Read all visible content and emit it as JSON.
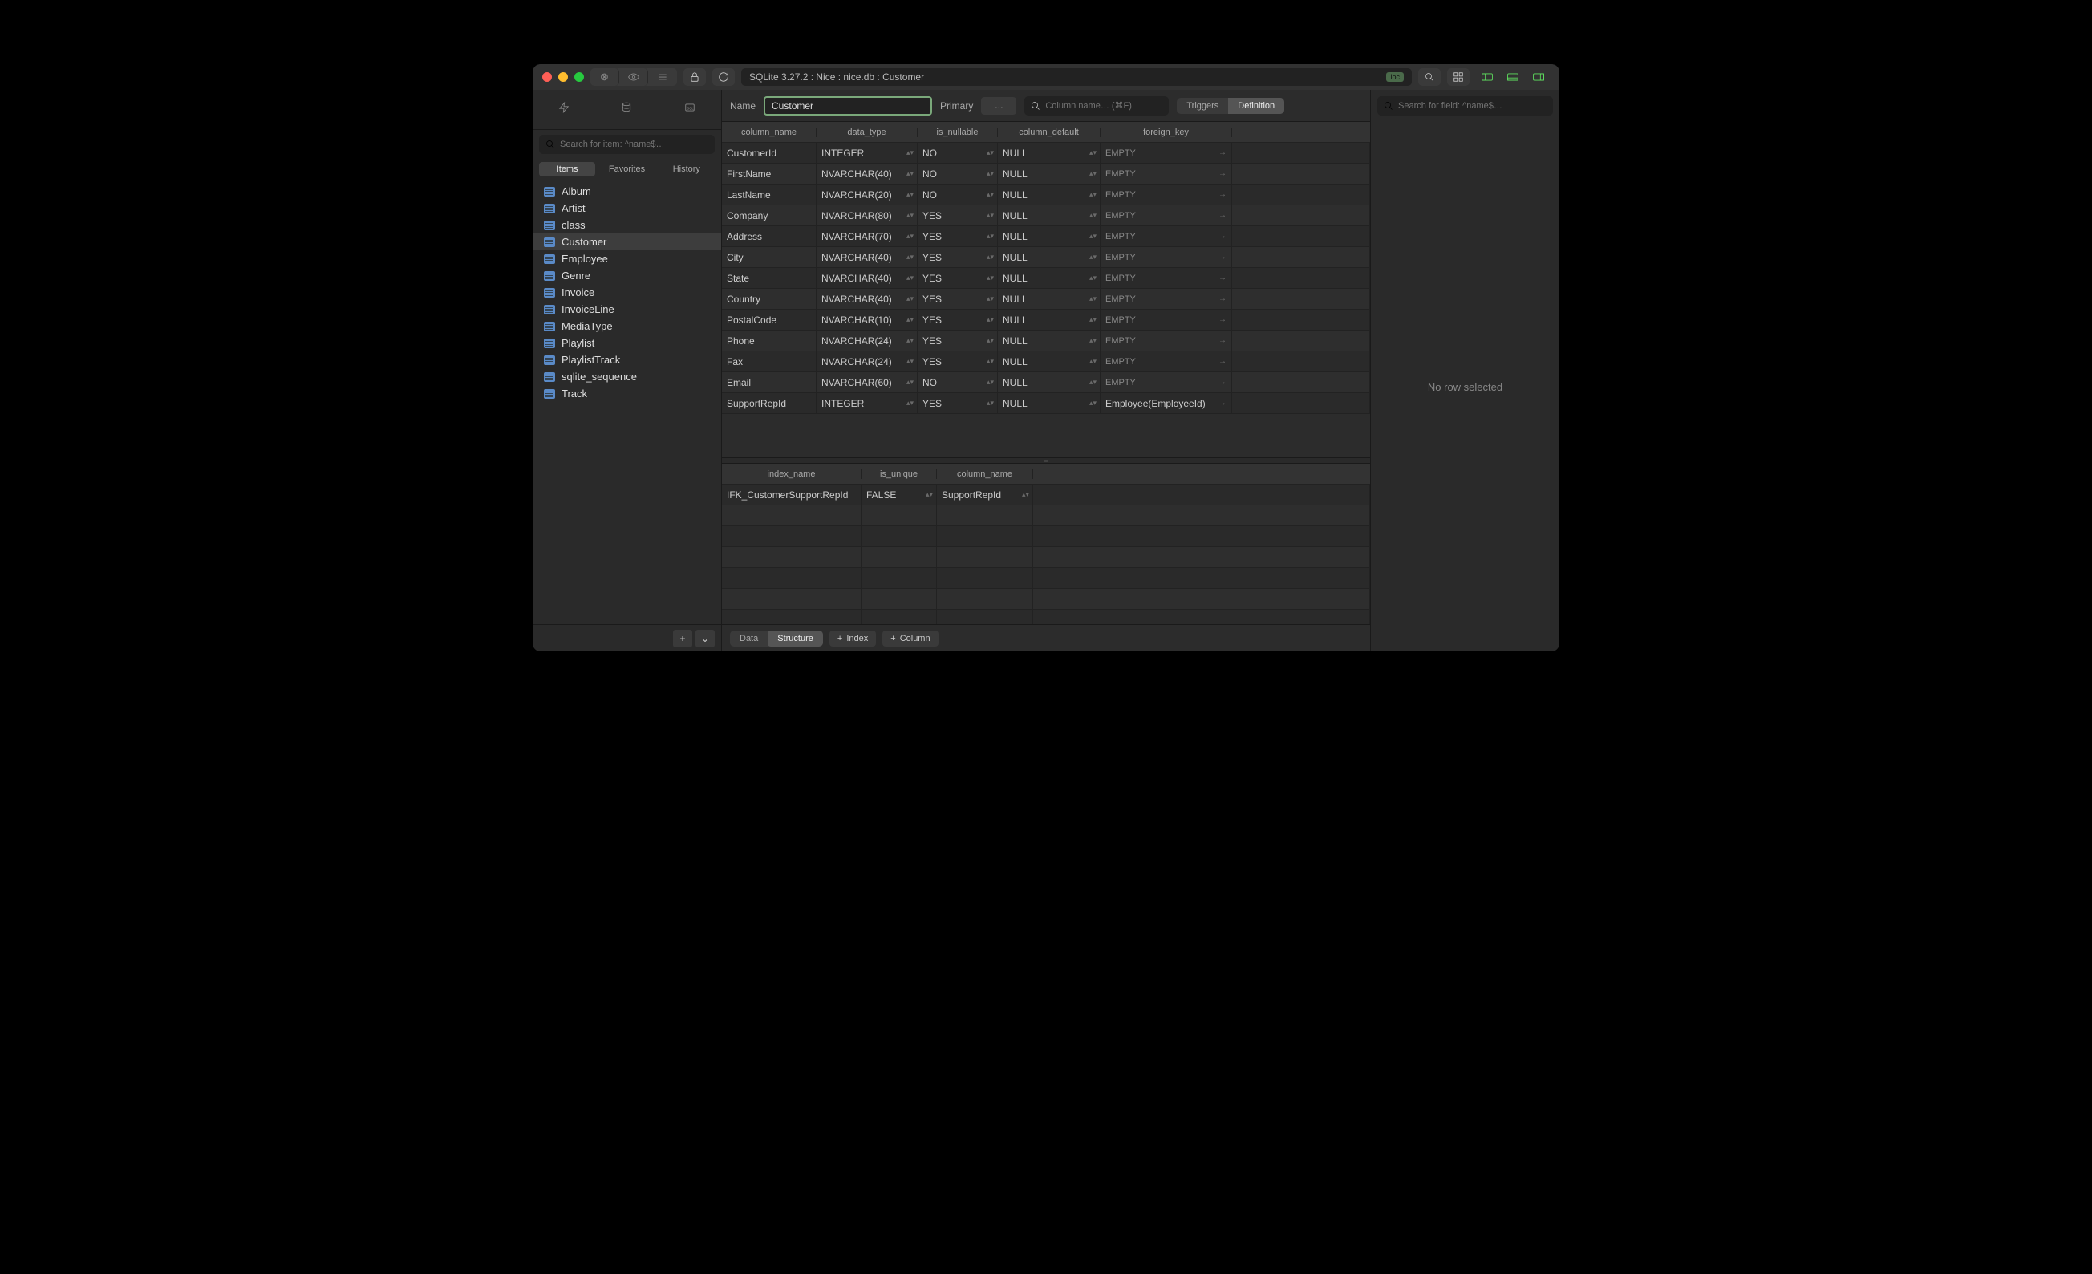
{
  "titlebar": {
    "path": "SQLite 3.27.2 : Nice : nice.db : Customer",
    "loc": "loc"
  },
  "sidebar": {
    "search_ph": "Search for item: ^name$…",
    "tabs": [
      "Items",
      "Favorites",
      "History"
    ],
    "items": [
      "Album",
      "Artist",
      "class",
      "Customer",
      "Employee",
      "Genre",
      "Invoice",
      "InvoiceLine",
      "MediaType",
      "Playlist",
      "PlaylistTrack",
      "sqlite_sequence",
      "Track"
    ],
    "selected": "Customer"
  },
  "header": {
    "name_label": "Name",
    "name_value": "Customer",
    "primary_label": "Primary",
    "primary_value": "…",
    "col_search_ph": "Column name… (⌘F)",
    "triggers": "Triggers",
    "definition": "Definition"
  },
  "columns_grid": {
    "headers": [
      "column_name",
      "data_type",
      "is_nullable",
      "column_default",
      "foreign_key"
    ],
    "rows": [
      {
        "n": "CustomerId",
        "t": "INTEGER",
        "u": "NO",
        "d": "NULL",
        "f": "EMPTY"
      },
      {
        "n": "FirstName",
        "t": "NVARCHAR(40)",
        "u": "NO",
        "d": "NULL",
        "f": "EMPTY"
      },
      {
        "n": "LastName",
        "t": "NVARCHAR(20)",
        "u": "NO",
        "d": "NULL",
        "f": "EMPTY"
      },
      {
        "n": "Company",
        "t": "NVARCHAR(80)",
        "u": "YES",
        "d": "NULL",
        "f": "EMPTY"
      },
      {
        "n": "Address",
        "t": "NVARCHAR(70)",
        "u": "YES",
        "d": "NULL",
        "f": "EMPTY"
      },
      {
        "n": "City",
        "t": "NVARCHAR(40)",
        "u": "YES",
        "d": "NULL",
        "f": "EMPTY"
      },
      {
        "n": "State",
        "t": "NVARCHAR(40)",
        "u": "YES",
        "d": "NULL",
        "f": "EMPTY"
      },
      {
        "n": "Country",
        "t": "NVARCHAR(40)",
        "u": "YES",
        "d": "NULL",
        "f": "EMPTY"
      },
      {
        "n": "PostalCode",
        "t": "NVARCHAR(10)",
        "u": "YES",
        "d": "NULL",
        "f": "EMPTY"
      },
      {
        "n": "Phone",
        "t": "NVARCHAR(24)",
        "u": "YES",
        "d": "NULL",
        "f": "EMPTY"
      },
      {
        "n": "Fax",
        "t": "NVARCHAR(24)",
        "u": "YES",
        "d": "NULL",
        "f": "EMPTY"
      },
      {
        "n": "Email",
        "t": "NVARCHAR(60)",
        "u": "NO",
        "d": "NULL",
        "f": "EMPTY"
      },
      {
        "n": "SupportRepId",
        "t": "INTEGER",
        "u": "YES",
        "d": "NULL",
        "f": "Employee(EmployeeId)"
      }
    ]
  },
  "index_grid": {
    "headers": [
      "index_name",
      "is_unique",
      "column_name"
    ],
    "rows": [
      {
        "n": "IFK_CustomerSupportRepId",
        "u": "FALSE",
        "c": "SupportRepId"
      }
    ]
  },
  "footer": {
    "data": "Data",
    "structure": "Structure",
    "index": "Index",
    "column": "Column"
  },
  "right": {
    "search_ph": "Search for field: ^name$…",
    "empty": "No row selected"
  }
}
